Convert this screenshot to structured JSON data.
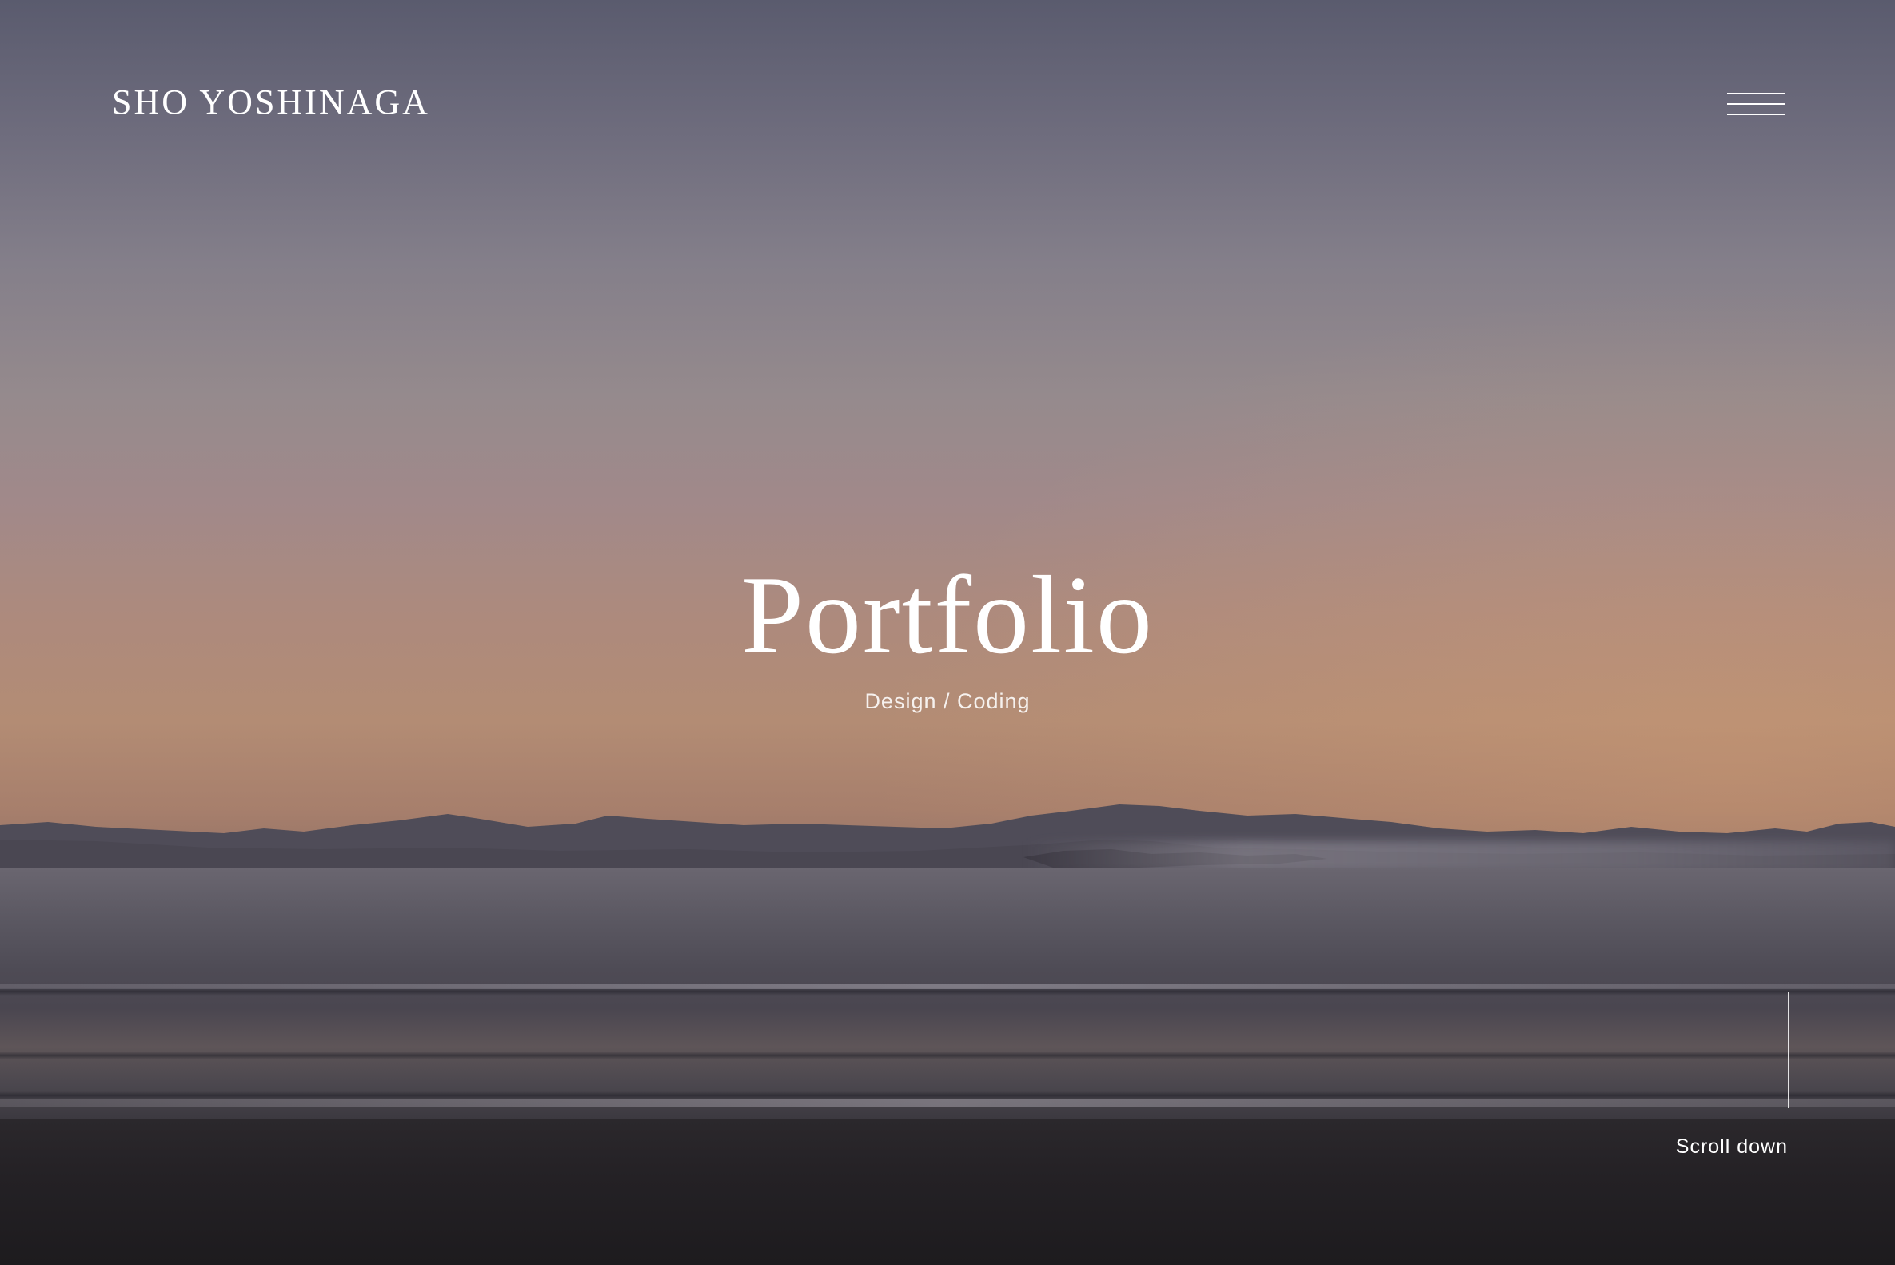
{
  "header": {
    "logo_text": "SHO YOSHINAGA",
    "menu_icon": "hamburger-menu-icon"
  },
  "hero": {
    "title": "Portfolio",
    "subtitle": "Design / Coding",
    "background": "sunset seascape photo"
  },
  "scroll": {
    "label": "Scroll down"
  },
  "colors": {
    "text": "#ffffff",
    "sky_top": "#5a5b6e",
    "sky_horizon": "#b38c74",
    "sea": "#4e4b55",
    "beach": "#1d1b1e"
  }
}
